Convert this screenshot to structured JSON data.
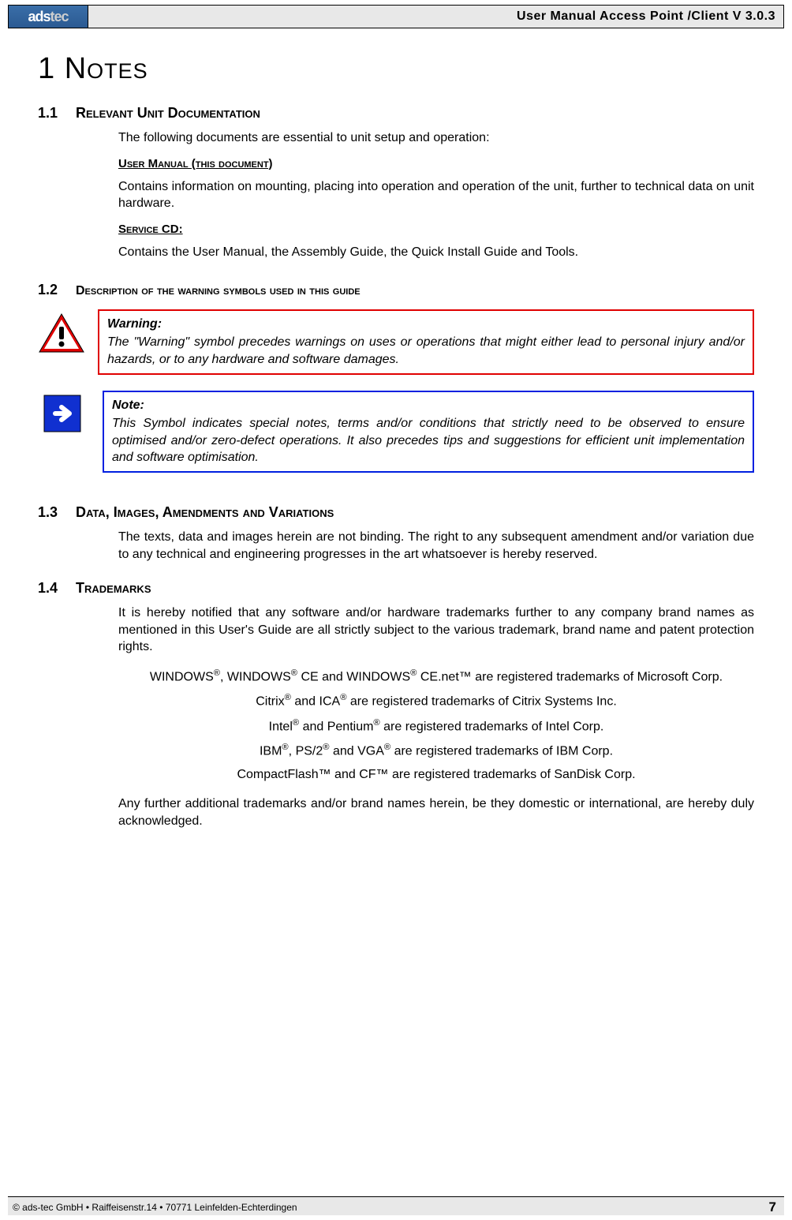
{
  "header": {
    "logo_a": "ads",
    "logo_b": "tec",
    "title": "User Manual Access  Point /Client V 3.0.3"
  },
  "chapter": {
    "title": "1  Notes"
  },
  "sections": {
    "s11": {
      "num": "1.1",
      "title": "Relevant Unit Documentation",
      "intro": "The following documents are essential to unit setup and operation:",
      "sub1_title": "User Manual (this document)",
      "sub1_body": "Contains information on mounting, placing into operation and operation of the unit, further to technical data on unit hardware.",
      "sub2_title": "Service CD:",
      "sub2_body": "Contains the User Manual, the Assembly Guide, the Quick Install Guide and Tools."
    },
    "s12": {
      "num": "1.2",
      "title": "Description of the warning symbols used in this guide",
      "warning_title": "Warning:",
      "warning_body": "The \"Warning\" symbol precedes warnings on uses or operations that might either lead to personal injury and/or hazards, or to any hardware and software damages.",
      "note_title": "Note:",
      "note_body": "This Symbol indicates special notes, terms and/or conditions that strictly need to be observed to ensure optimised and/or zero-defect operations. It also precedes tips and suggestions for efficient unit implementation and software optimisation."
    },
    "s13": {
      "num": "1.3",
      "title": "Data, Images, Amendments and Variations",
      "body": "The texts, data and images herein are not binding. The right to any subsequent amendment and/or variation due to any technical and engineering progresses in the art whatsoever is hereby reserved."
    },
    "s14": {
      "num": "1.4",
      "title": "Trademarks",
      "intro": "It is hereby notified that any software and/or hardware trademarks further to any company brand names as mentioned in this User's Guide are all strictly subject to the various trademark, brand name and patent protection rights.",
      "tm1": "WINDOWS®, WINDOWS® CE and WINDOWS® CE.net™ are registered trademarks of Microsoft Corp.",
      "tm2": "Citrix® and ICA® are registered trademarks of Citrix Systems Inc.",
      "tm3": "Intel® and Pentium® are registered trademarks of Intel Corp.",
      "tm4": "IBM®, PS/2® and VGA® are registered trademarks of IBM Corp.",
      "tm5": "CompactFlash™ and CF™ are registered trademarks of SanDisk Corp.",
      "outro": "Any further additional trademarks and/or brand names herein, be they domestic or international, are hereby duly acknowledged."
    }
  },
  "footer": {
    "left": "© ads-tec GmbH • Raiffeisenstr.14 • 70771 Leinfelden-Echterdingen",
    "right": "7"
  }
}
